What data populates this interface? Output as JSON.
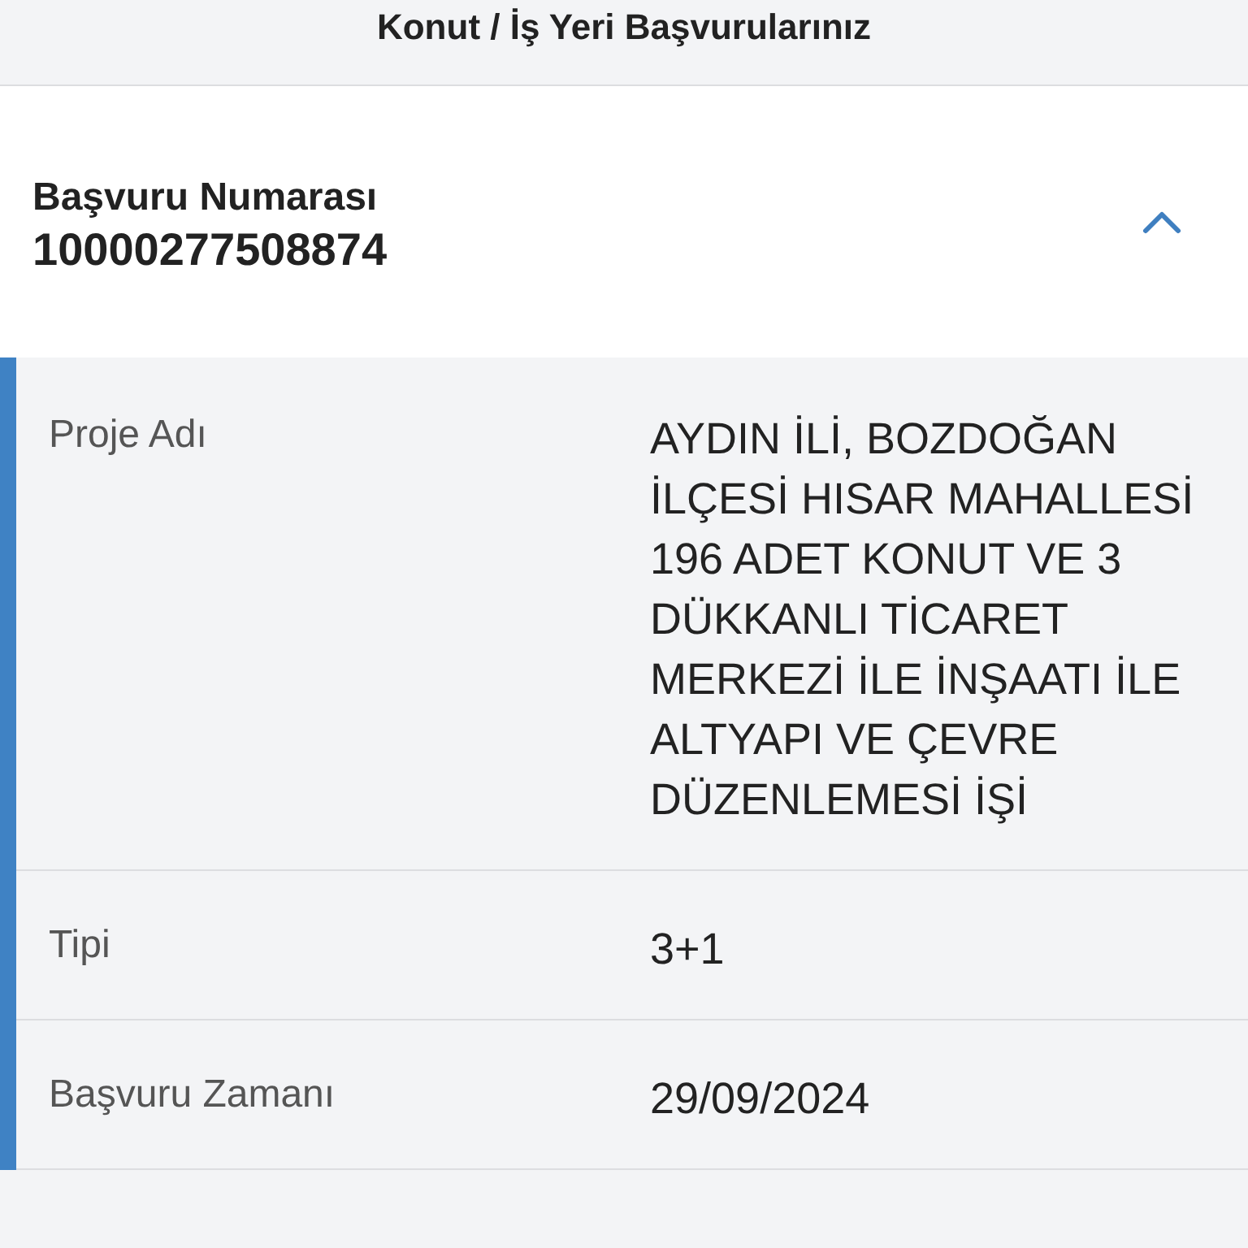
{
  "header": {
    "title": "Konut / İş Yeri Başvurularınız"
  },
  "application": {
    "number_label": "Başvuru Numarası",
    "number": "10000277508874",
    "expanded": true,
    "details": [
      {
        "label": "Proje Adı",
        "value": "AYDIN İLİ, BOZDOĞAN İLÇESİ HISAR MAHALLESİ 196 ADET KONUT VE 3 DÜKKANLI TİCARET MERKEZİ İLE İNŞAATI İLE ALTYAPI VE ÇEVRE DÜZENLEMESİ İŞİ"
      },
      {
        "label": "Tipi",
        "value": "3+1"
      },
      {
        "label": "Başvuru Zamanı",
        "value": "29/09/2024"
      }
    ]
  }
}
